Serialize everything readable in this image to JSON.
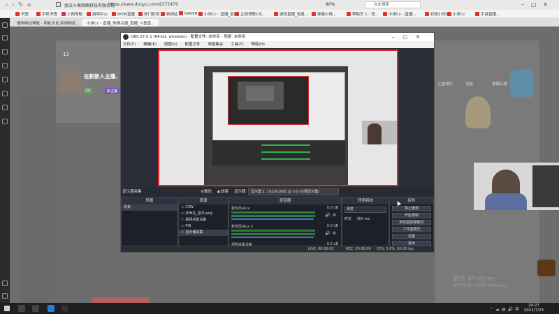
{
  "browser": {
    "site_name": "武汉斗鱼网络科技有限公司",
    "url": "https://www.douyu.com/6372479",
    "zoom": "90%",
    "search_placeholder": "在此搜索",
    "bookmarks": [
      "书签",
      "手机书签",
      "上网导航",
      "游戏中心",
      "NOW直播",
      "热门影视",
      "新闻站",
      "NAVER",
      "小米Cc - 直播_全网",
      "立刻领取1元...",
      "游戏直播_有道...",
      "穿越火线...",
      "帮助页 1 - 任...",
      "小米Cc - 直播...",
      "石斑小白1",
      "小米Cc",
      "手游直播..."
    ],
    "tabs": [
      "搜狗网址导航 - 网址大全,实用网址...",
      "小米Cc - 直播_热情主播_直播_斗鱼直..."
    ],
    "tab_active_index": 1
  },
  "page": {
    "stat_number": "12",
    "streamer_title": "在新新人主播、点",
    "level_badge": "LV",
    "tag_label": "新主播",
    "right_labels": [
      "主播排行",
      "贡献",
      "弹幕礼物"
    ],
    "activate_title": "激活 Windows",
    "activate_sub": "转到\"设置\"以激活 Windows。"
  },
  "obs": {
    "title": "OBS 27.0.1 (64-bit, windows) - 配置文件: 未命名 - 场景: 未命名",
    "menu": [
      "文件(F)",
      "编辑(E)",
      "视图(V)",
      "工具(T)",
      "帮助(H)",
      "场景集合",
      "配置文件"
    ],
    "preview_label": "显示器采集",
    "properties_button": "属性",
    "filters_button": "滤镜",
    "display_label": "显示器",
    "display_value": "显示器 1: 1920x1080 @ 0,0 (主要显示器)",
    "docks": {
      "scenes": {
        "title": "场景",
        "items": [
          "场景"
        ]
      },
      "sources": {
        "title": "来源",
        "items": [
          "CSW",
          "未命名_副本.png",
          "视频采集设备",
          "FIN",
          "显示器采集"
        ]
      },
      "mixer": {
        "title": "混音器",
        "channels": [
          {
            "name": "麦克风/Aux",
            "db": "0.0 dB"
          },
          {
            "name": "麦克风/Aux 2",
            "db": "0.0 dB"
          },
          {
            "name": "视频采集设备",
            "db": "0.0 dB"
          }
        ]
      },
      "transitions": {
        "title": "转场特效",
        "mode": "渐变",
        "duration_label": "时长",
        "duration": "300 ms"
      },
      "controls": {
        "title": "控件",
        "buttons": [
          "停止推流",
          "开始录制",
          "启动虚拟摄像机",
          "工作室模式",
          "设置",
          "退出"
        ]
      }
    },
    "status": {
      "live": "LIVE: 00:00:00",
      "rec": "REC: 00:00:00",
      "cpu": "CPU: 5.0%, 60.00 fps"
    }
  },
  "taskbar": {
    "time": "20:27",
    "date": "2021/7/23"
  }
}
